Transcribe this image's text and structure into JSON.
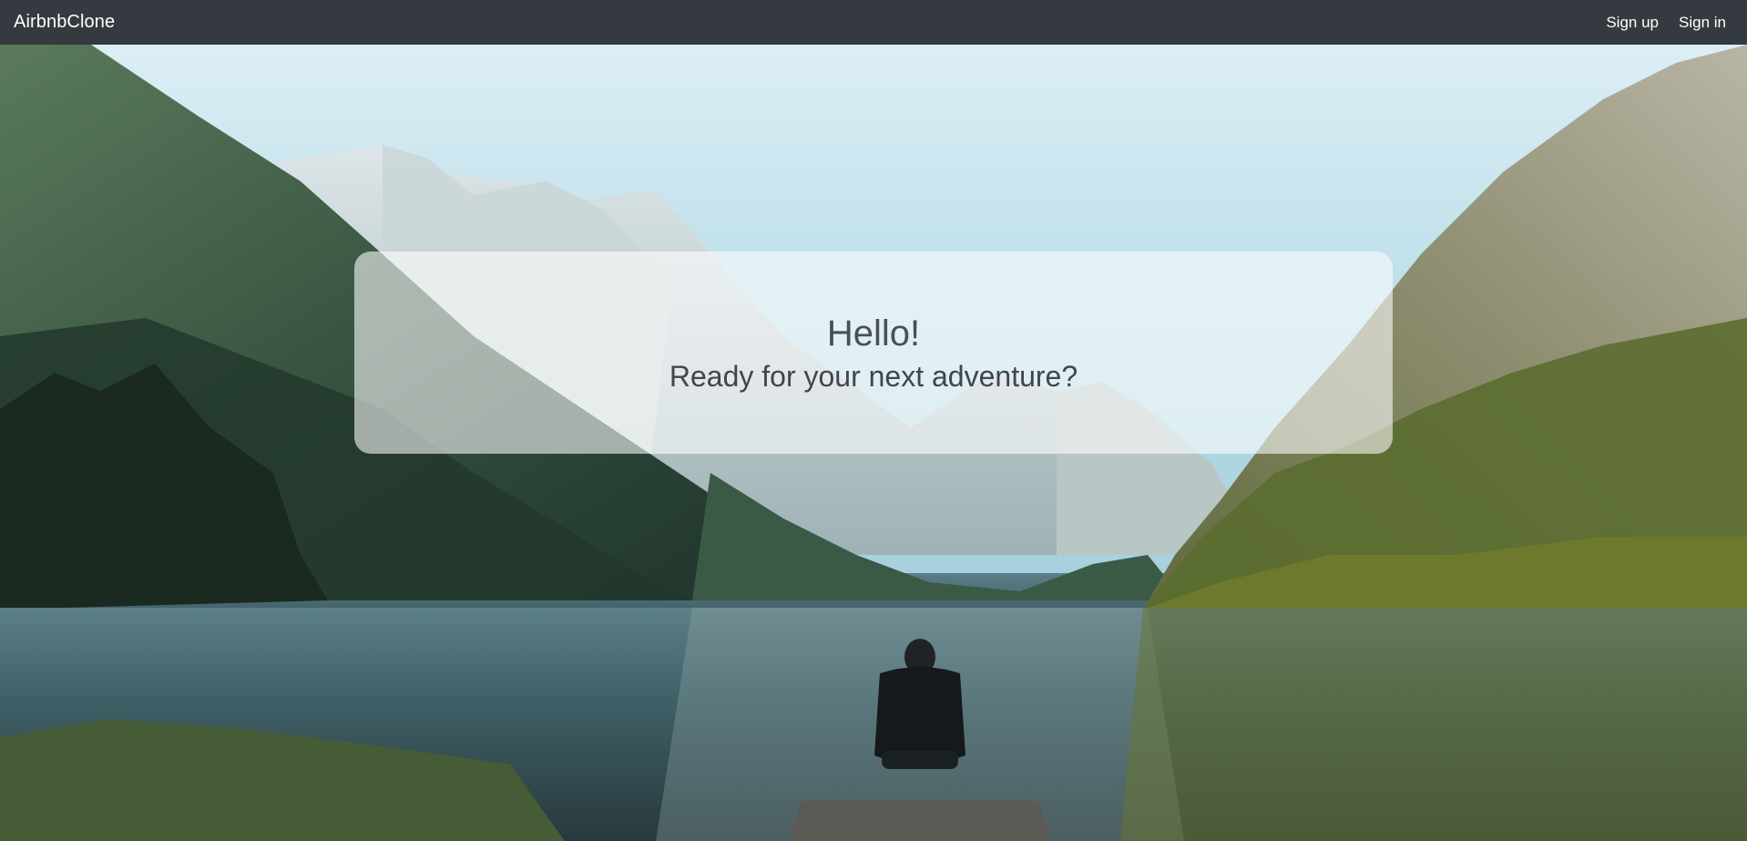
{
  "navbar": {
    "brand": "AirbnbClone",
    "links": [
      {
        "label": "Sign up"
      },
      {
        "label": "Sign in"
      }
    ]
  },
  "hero": {
    "title": "Hello!",
    "subtitle": "Ready for your next adventure?",
    "image_description_icon": "mountain-lake-photo"
  },
  "colors": {
    "navbar_bg": "#343a40",
    "nav_text": "#ffffff",
    "card_bg": "rgba(255,255,255,0.58)",
    "title_text": "#4a4f55"
  }
}
